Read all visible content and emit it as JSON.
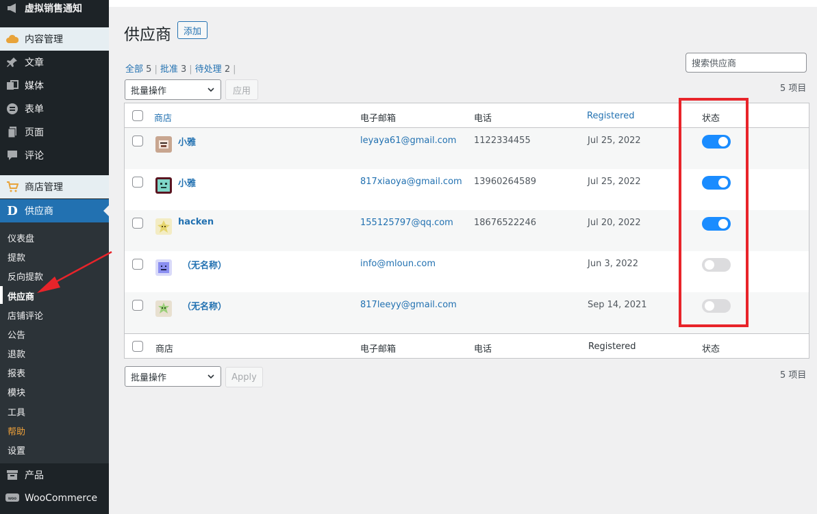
{
  "sidebar": {
    "top_item": "虚拟销售通知",
    "items": [
      {
        "label": "内容管理",
        "icon": "cloud-icon",
        "sep": true
      },
      {
        "label": "文章",
        "icon": "pin-icon"
      },
      {
        "label": "媒体",
        "icon": "media-icon"
      },
      {
        "label": "表单",
        "icon": "form-icon"
      },
      {
        "label": "页面",
        "icon": "page-icon"
      },
      {
        "label": "评论",
        "icon": "comment-icon"
      },
      {
        "label": "商店管理",
        "icon": "cart-icon",
        "sep": true
      },
      {
        "label": "供应商",
        "icon": "dokan-icon",
        "active": true
      }
    ],
    "submenu": [
      "仪表盘",
      "提款",
      "反向提款",
      "供应商",
      "店铺评论",
      "公告",
      "退款",
      "报表",
      "模块",
      "工具",
      "帮助",
      "设置"
    ],
    "bottom_items": [
      {
        "label": "产品",
        "icon": "archive-icon"
      },
      {
        "label": "WooCommerce",
        "icon": "woo-icon"
      }
    ]
  },
  "header": {
    "title": "供应商",
    "add_label": "添加"
  },
  "filters": {
    "all_label": "全部",
    "all_count": "5",
    "approved_label": "批准",
    "approved_count": "3",
    "pending_label": "待处理",
    "pending_count": "2"
  },
  "search": {
    "placeholder": "搜索供应商"
  },
  "bulk_top": {
    "label": "批量操作",
    "apply": "应用"
  },
  "bulk_bottom": {
    "label": "批量操作",
    "apply": "Apply"
  },
  "items_count": "5 项目",
  "table": {
    "headers": {
      "store": "商店",
      "email": "电子邮箱",
      "phone": "电话",
      "registered": "Registered",
      "status": "状态"
    },
    "rows": [
      {
        "store": "小雅",
        "email": "leyaya61@gmail.com",
        "phone": "1122334455",
        "registered": "Jul 25, 2022",
        "enabled": true,
        "avatar_color": "#c8a690"
      },
      {
        "store": "小雅",
        "email": "817xiaoya@gmail.com",
        "phone": "13960264589",
        "registered": "Jul 25, 2022",
        "enabled": true,
        "avatar_color": "#7fd6c8"
      },
      {
        "store": "hacken",
        "email": "155125797@qq.com",
        "phone": "18676522246",
        "registered": "Jul 20, 2022",
        "enabled": true,
        "avatar_color": "#e6d66e"
      },
      {
        "store": "（无名称）",
        "email": "info@mloun.com",
        "phone": "",
        "registered": "Jun 3, 2022",
        "enabled": false,
        "avatar_color": "#8a8ef0"
      },
      {
        "store": "（无名称）",
        "email": "817leeyy@gmail.com",
        "phone": "",
        "registered": "Sep 14, 2021",
        "enabled": false,
        "avatar_color": "#9ccf7a"
      }
    ]
  },
  "colors": {
    "accent": "#2271b1",
    "toggle_on": "#1a8cff",
    "annotation": "#e8242a"
  }
}
